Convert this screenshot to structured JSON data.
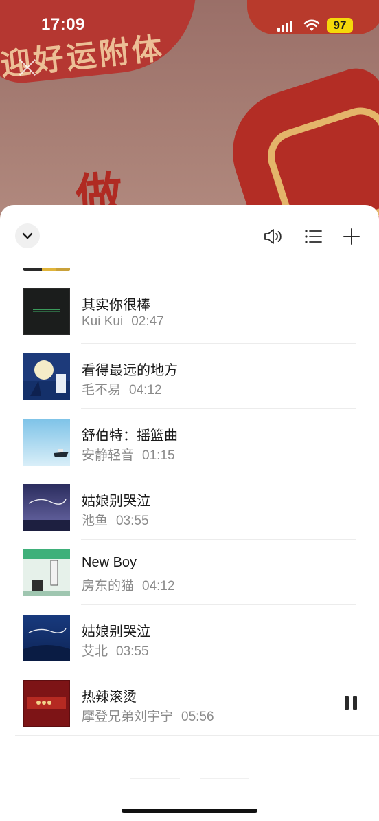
{
  "status_bar": {
    "time": "17:09",
    "battery": "97"
  },
  "background": {
    "banner_text": "迎好运附体",
    "big_char": "做"
  },
  "header": {
    "collapse_icon": "chevron-down-icon",
    "volume_icon": "volume-icon",
    "list_icon": "list-icon",
    "add_icon": "plus-icon"
  },
  "tracks": [
    {
      "title": "其实你很棒",
      "artist": "Kui Kui",
      "duration": "02:47"
    },
    {
      "title": "看得最远的地方",
      "artist": "毛不易",
      "duration": "04:12"
    },
    {
      "title": "舒伯特：摇篮曲",
      "artist": "安静轻音",
      "duration": "01:15"
    },
    {
      "title": "姑娘别哭泣",
      "artist": "池鱼",
      "duration": "03:55"
    },
    {
      "title": "New Boy",
      "artist": "房东的猫",
      "duration": "04:12"
    },
    {
      "title": "姑娘别哭泣",
      "artist": "艾北",
      "duration": "03:55"
    },
    {
      "title": "热辣滚烫",
      "artist": "摩登兄弟刘宇宁",
      "duration": "05:56"
    }
  ],
  "colors": {
    "accent_battery": "#f5d90a",
    "sheet_bg": "#ffffff",
    "primary_text": "#1a1a1a",
    "secondary_text": "#8a8a8a"
  }
}
